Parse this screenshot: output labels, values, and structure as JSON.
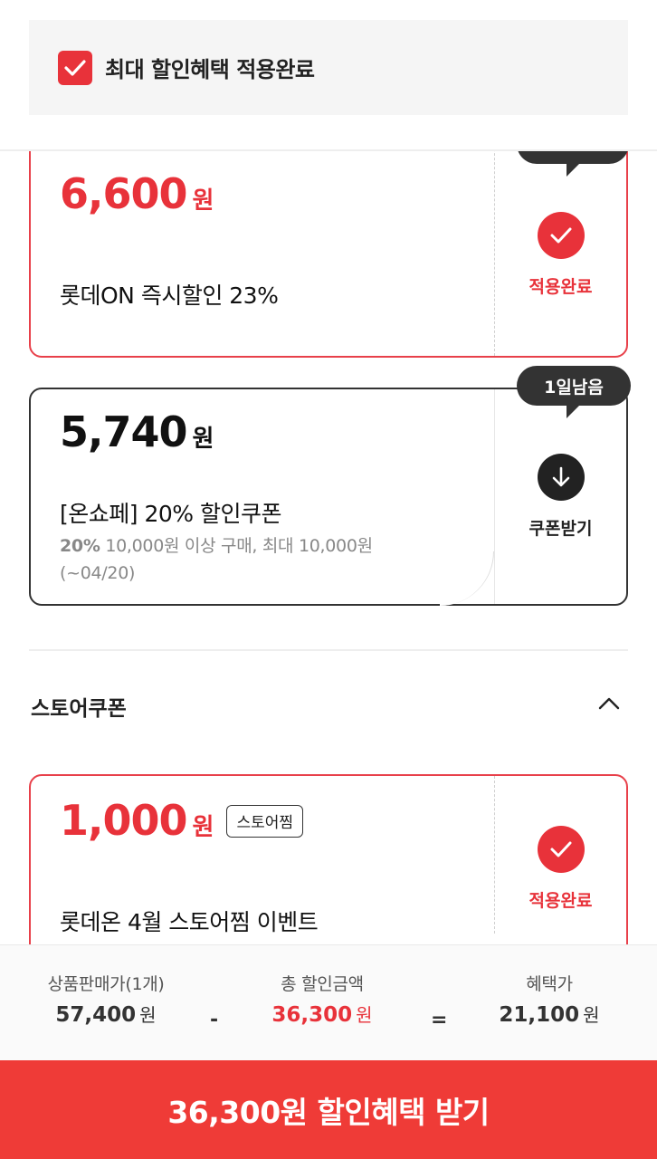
{
  "banner": {
    "text": "최대 할인혜택 적용완료"
  },
  "coupons": [
    {
      "amount": "6,600",
      "unit": "원",
      "title": "롯데ON 즉시할인 23%",
      "status": "적용완료"
    },
    {
      "amount": "5,740",
      "unit": "원",
      "title": "[온쇼페] 20% 할인쿠폰",
      "desc_bold": "20%",
      "desc_rest": " 10,000원 이상 구매, 최대 10,000원",
      "desc_date": "(~04/20)",
      "badge": "1일남음",
      "status": "쿠폰받기"
    }
  ],
  "store_section": {
    "title": "스토어쿠폰",
    "coupon": {
      "amount": "1,000",
      "unit": "원",
      "tag": "스토어찜",
      "title": "롯데온 4월 스토어찜 이벤트",
      "status": "적용완료"
    }
  },
  "summary": {
    "price_label": "상품판매가(1개)",
    "price_value": "57,400",
    "price_unit": "원",
    "minus": "-",
    "discount_label": "총 할인금액",
    "discount_value": "36,300",
    "discount_unit": "원",
    "equals": "=",
    "final_label": "혜택가",
    "final_value": "21,100",
    "final_unit": "원"
  },
  "cta": {
    "label": "36,300원 할인혜택 받기"
  },
  "colors": {
    "accent": "#e8323a",
    "cta": "#ef3b37",
    "dark": "#222222"
  }
}
